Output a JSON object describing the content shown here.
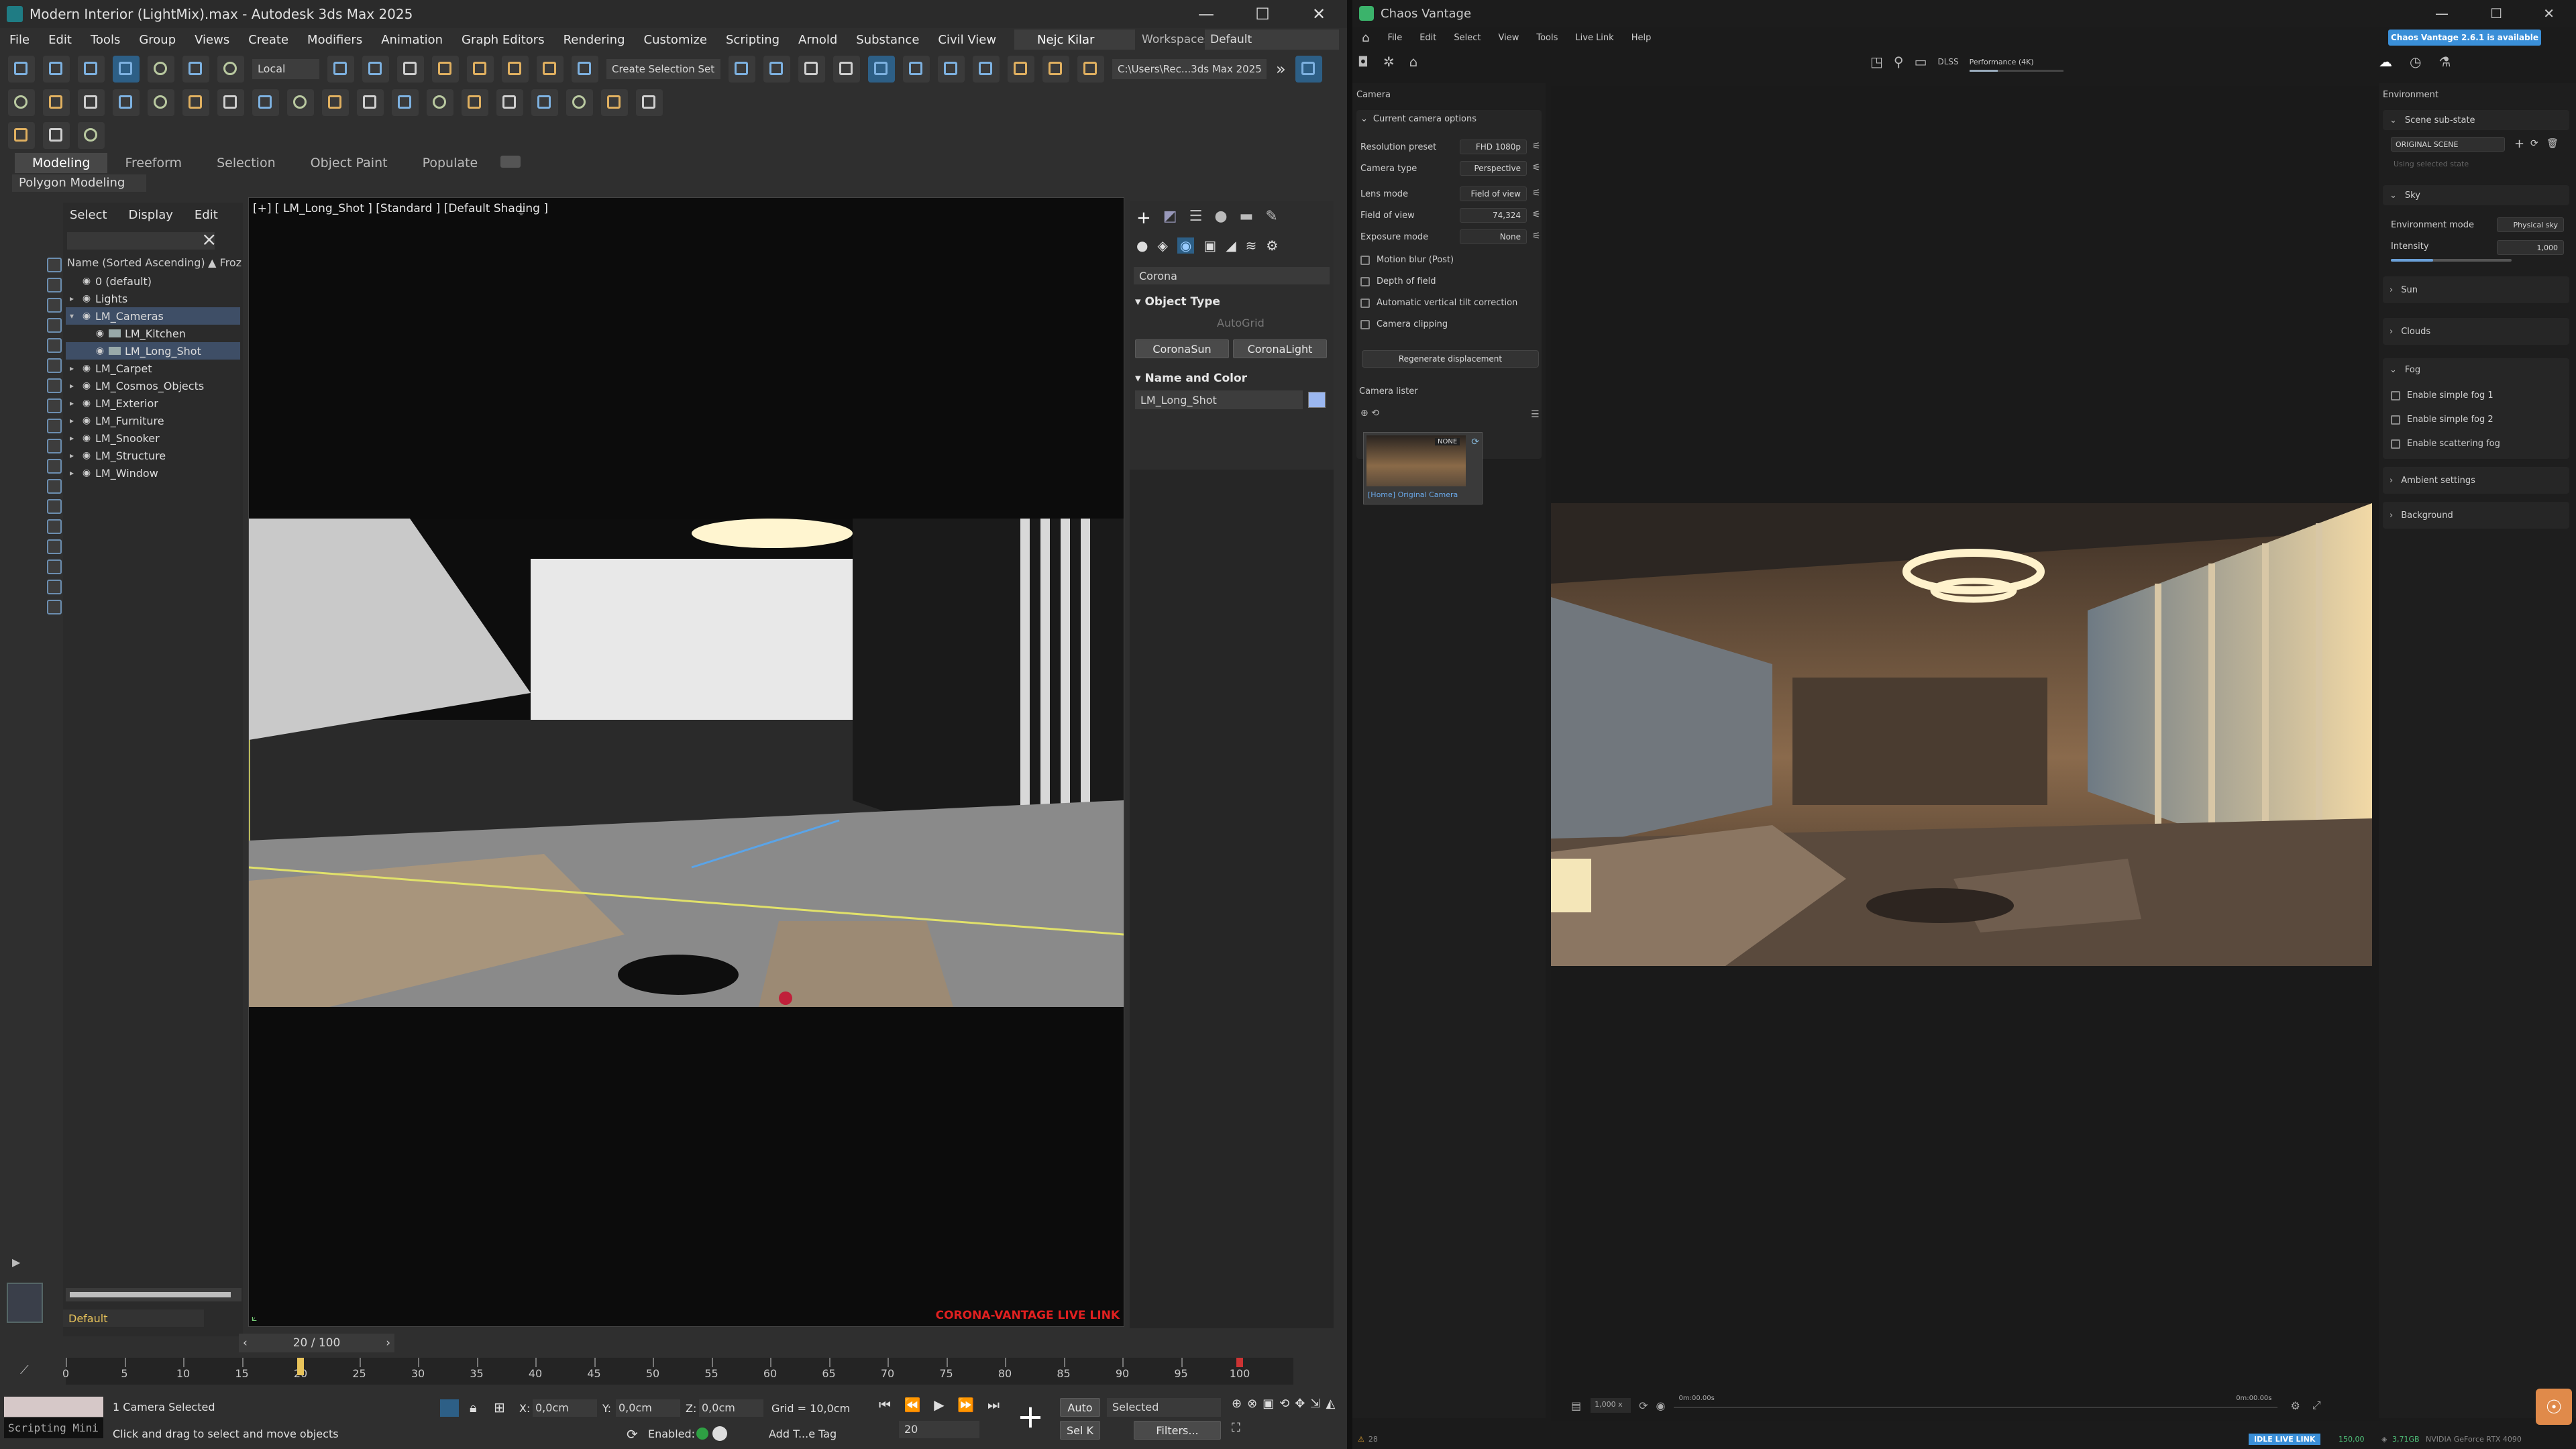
{
  "max": {
    "title": "Modern Interior (LightMix).max - Autodesk 3ds Max 2025",
    "menu": [
      "File",
      "Edit",
      "Tools",
      "Group",
      "Views",
      "Create",
      "Modifiers",
      "Animation",
      "Graph Editors",
      "Rendering",
      "Customize",
      "Scripting",
      "Arnold",
      "Substance",
      "Civil View",
      "Help"
    ],
    "user": "Nejc Kilar",
    "workspaces_label": "Workspaces:",
    "workspace": "Default",
    "ref_coord": "Local",
    "selection_set": "Create Selection Set",
    "project_path": "C:\\Users\\Rec...3ds Max 2025",
    "ribbon_tabs": [
      "Modeling",
      "Freeform",
      "Selection",
      "Object Paint",
      "Populate"
    ],
    "ribbon_sub": "Polygon Modeling",
    "explorer_tabs": [
      "Select",
      "Display",
      "Edit"
    ],
    "explorer_header": "Name (Sorted Ascending)",
    "explorer_frozen": "▲ Froz",
    "tree": [
      {
        "name": "0 (default)",
        "indent": 1,
        "expand": ""
      },
      {
        "name": "Lights",
        "indent": 1,
        "expand": "▸"
      },
      {
        "name": "LM_Cameras",
        "indent": 1,
        "expand": "▾",
        "sel": true
      },
      {
        "name": "LM_Kitchen",
        "indent": 2,
        "expand": ""
      },
      {
        "name": "LM_Long_Shot",
        "indent": 2,
        "expand": "",
        "sel": true
      },
      {
        "name": "LM_Carpet",
        "indent": 1,
        "expand": "▸"
      },
      {
        "name": "LM_Cosmos_Objects",
        "indent": 1,
        "expand": "▸"
      },
      {
        "name": "LM_Exterior",
        "indent": 1,
        "expand": "▸"
      },
      {
        "name": "LM_Furniture",
        "indent": 1,
        "expand": "▸"
      },
      {
        "name": "LM_Snooker",
        "indent": 1,
        "expand": "▸"
      },
      {
        "name": "LM_Structure",
        "indent": 1,
        "expand": "▸"
      },
      {
        "name": "LM_Window",
        "indent": 1,
        "expand": "▸"
      }
    ],
    "layer_default": "Default",
    "viewport_label": "[+] [ LM_Long_Shot ] [Standard ] [Default Shading ]",
    "live_link_label": "CORONA-VANTAGE LIVE LINK",
    "renderer_dropdown": "Corona",
    "object_type_title": "Object Type",
    "autogrid": "AutoGrid",
    "btn_sun": "CoronaSun",
    "btn_light": "CoronaLight",
    "name_color_title": "Name and Color",
    "object_name": "LM_Long_Shot",
    "frame_counter": "20 / 100",
    "ticks": [
      "0",
      "5",
      "10",
      "15",
      "20",
      "25",
      "30",
      "35",
      "40",
      "45",
      "50",
      "55",
      "60",
      "65",
      "70",
      "75",
      "80",
      "85",
      "90",
      "95",
      "100"
    ],
    "current_frame": 20,
    "status_selected": "1 Camera Selected",
    "status_hint": "Click and drag to select and move objects",
    "maxscript": "Scripting Mini",
    "x_label": "X:",
    "x_value": "0,0cm",
    "y_label": "Y:",
    "y_value": "0,0cm",
    "z_label": "Z:",
    "z_value": "0,0cm",
    "grid": "Grid = 10,0cm",
    "enabled_label": "Enabled:",
    "add_tag": "Add T...e Tag",
    "auto_key": "Auto",
    "set_key": "Sel K",
    "key_filter": "Selected",
    "filters": "Filters...",
    "frame_field": "20"
  },
  "vantage": {
    "title": "Chaos Vantage",
    "menu": [
      "File",
      "Edit",
      "Select",
      "View",
      "Tools",
      "Live Link",
      "Help"
    ],
    "update_badge": "Chaos Vantage 2.6.1 is available",
    "perf_label": "Performance (4K)",
    "dlss": "DLSS",
    "camera_title": "Camera",
    "current_cam_section": "Current camera options",
    "rows": [
      {
        "label": "Resolution preset",
        "value": "FHD 1080p"
      },
      {
        "label": "Camera type",
        "value": "Perspective"
      },
      {
        "label": "Lens mode",
        "value": "Field of view"
      },
      {
        "label": "Field of view",
        "value": "74,324"
      },
      {
        "label": "Exposure mode",
        "value": "None"
      }
    ],
    "checks": [
      "Motion blur (Post)",
      "Depth of field",
      "Automatic vertical tilt correction",
      "Camera clipping"
    ],
    "regen_btn": "Regenerate displacement",
    "cam_lister": "Camera lister",
    "thumb_badge": "NONE",
    "thumb_caption": "[Home] Original Camera",
    "env_title": "Environment",
    "scene_state_section": "Scene sub-state",
    "scene_state_value": "ORIGINAL SCENE",
    "scene_state_hint": "Using selected state",
    "sky_section": "Sky",
    "env_mode_label": "Environment mode",
    "env_mode_value": "Physical sky",
    "intensity_label": "Intensity",
    "intensity_value": "1,000",
    "intensity_level": 0.35,
    "sun_section": "Sun",
    "clouds_section": "Clouds",
    "fog_section": "Fog",
    "fog_checks": [
      "Enable simple fog 1",
      "Enable simple fog 2",
      "Enable scattering fog"
    ],
    "ambient_section": "Ambient settings",
    "background_section": "Background",
    "timeline_zoom": "1,000 x",
    "time_start": "0m:00.00s",
    "time_end": "0m:00.00s",
    "live_link_status": "IDLE LIVE LINK",
    "fps": "150,00",
    "vram": "3,71GB",
    "gpu": "NVIDIA GeForce RTX 4090",
    "triangles": "28"
  },
  "colors": {
    "accent": "#5b9bd5",
    "selected_row": "#3e4e66",
    "live_link_red": "#e02020",
    "viewport_border": "#e1e16a",
    "badge": "#3a8fd8"
  }
}
